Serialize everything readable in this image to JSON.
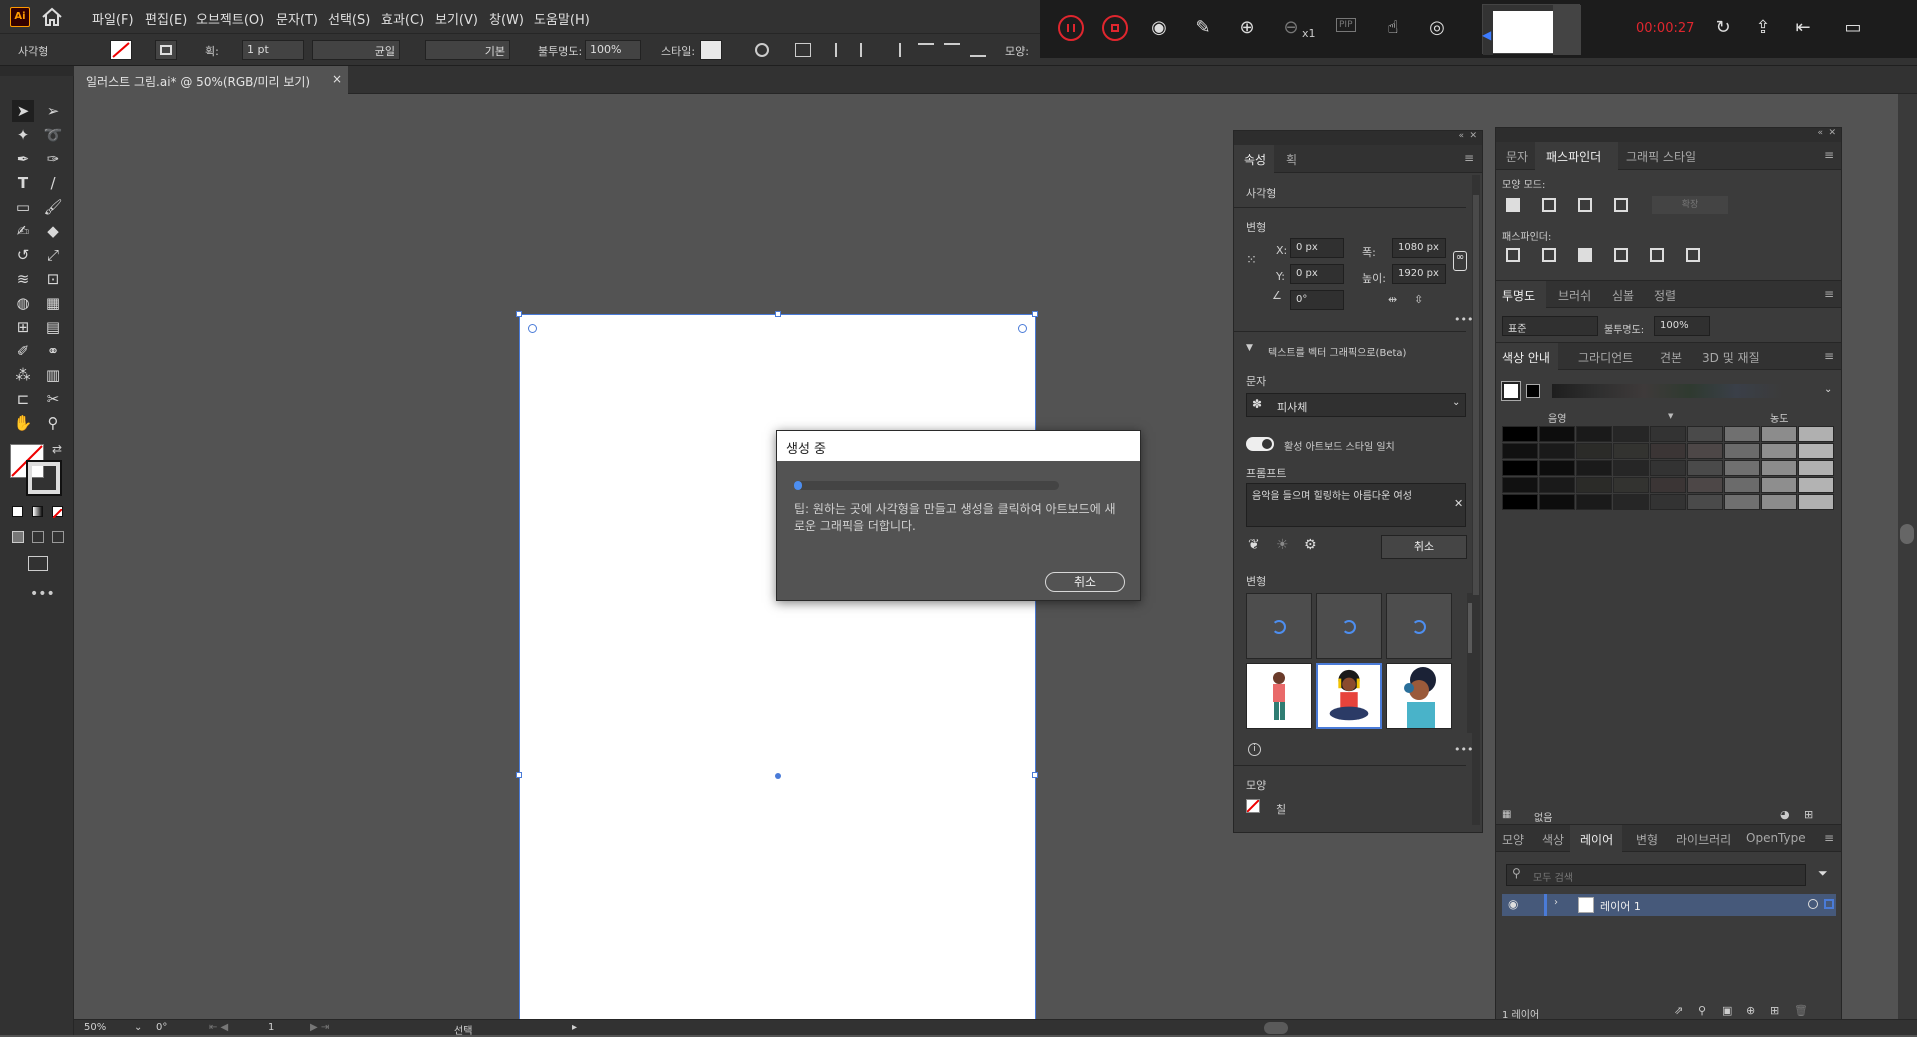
{
  "app": {
    "logo": "Ai",
    "home_icon": "home-icon"
  },
  "menu": [
    "파일(F)",
    "편집(E)",
    "오브젝트(O)",
    "문자(T)",
    "선택(S)",
    "효과(C)",
    "보기(V)",
    "창(W)",
    "도움말(H)"
  ],
  "control": {
    "object_type": "사각형",
    "stroke_label": "획:",
    "stroke_weight": "1 pt",
    "profile_label": "균일",
    "brush_label": "기본",
    "opacity_label": "불투명도:",
    "opacity_value": "100%",
    "style_label": "스타일:",
    "shape_label": "모양:"
  },
  "recorder": {
    "time": "00:00:27",
    "zoom": "x1",
    "pip": "PIP"
  },
  "document_tab": {
    "title": "일러스트 그림.ai* @ 50%(RGB/미리 보기)",
    "close": "×"
  },
  "dialog": {
    "title": "생성 중",
    "progress_fraction": 0.03,
    "tip": "팁: 원하는 곳에 사각형을 만들고 생성을 클릭하여 아트보드에 새로운 그래픽을 더합니다.",
    "cancel": "취소"
  },
  "properties": {
    "tabs": [
      "속성",
      "획"
    ],
    "object": "사각형",
    "transform_title": "변형",
    "x_label": "X:",
    "x": "0 px",
    "y_label": "Y:",
    "y": "0 px",
    "w_label": "폭:",
    "w": "1080 px",
    "h_label": "높이:",
    "h": "1920 px",
    "angle": "0°",
    "text_to_vector": "텍스트를 벡터 그래픽으로(Beta)",
    "type_label": "문자",
    "type_value": "피사체",
    "match_style": "활성 아트보드 스타일 일치",
    "prompt_label": "프롬프트",
    "prompt": "음악을 들으며 힐링하는 아름다운 여성",
    "cancel": "취소",
    "variations_label": "변형",
    "appearance_label": "모양",
    "fill_label": "칠"
  },
  "right_panel": {
    "tabs1": [
      "문자",
      "패스파인더",
      "그래픽 스타일"
    ],
    "shape_modes": "모양 모드:",
    "expand": "확장",
    "pathfinders": "패스파인더:",
    "tabs2": [
      "투명도",
      "브러쉬",
      "심볼",
      "정렬"
    ],
    "blend_mode": "표준",
    "opacity_label": "불투명도:",
    "opacity": "100%",
    "tabs3": [
      "색상 안내",
      "그라디언트",
      "견본",
      "3D 및 재질"
    ],
    "shade_label": "음영",
    "tint_label": "농도",
    "none_label": "없음",
    "tabs4": [
      "모양",
      "색상",
      "레이어",
      "변형",
      "라이브러리",
      "OpenType"
    ],
    "search_placeholder": "모두 검색",
    "layer_name": "레이어 1",
    "layer_count": "1 레이어"
  },
  "status": {
    "zoom": "50%",
    "rotation": "0°",
    "artboard": "1",
    "tool": "선택"
  },
  "colors": {
    "accent": "#4a7bd8",
    "record_red": "#e0262e",
    "progress": "#4d8ef0"
  }
}
